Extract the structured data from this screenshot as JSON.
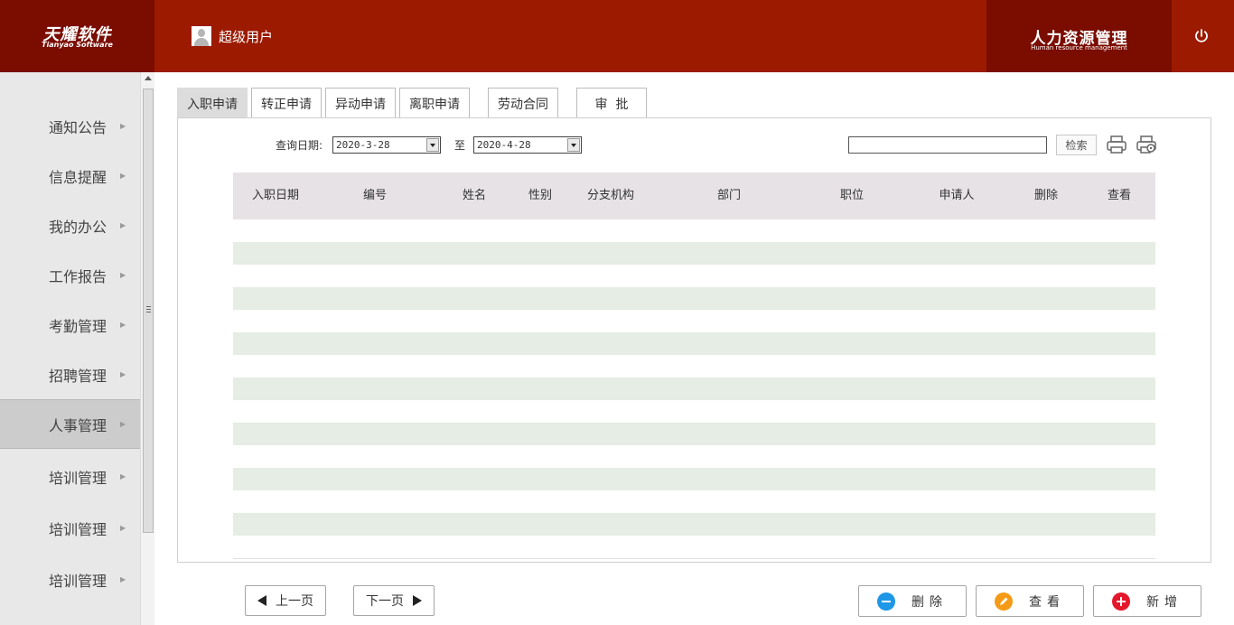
{
  "header": {
    "logo_cn": "天耀软件",
    "logo_en": "Tianyao Software",
    "user_name": "超级用户",
    "module_cn": "人力资源管理",
    "module_en": "Human resource management"
  },
  "sidebar": {
    "items": [
      {
        "label": "通知公告"
      },
      {
        "label": "信息提醒"
      },
      {
        "label": "我的办公"
      },
      {
        "label": "工作报告"
      },
      {
        "label": "考勤管理"
      },
      {
        "label": "招聘管理"
      },
      {
        "label": "人事管理",
        "active": true
      },
      {
        "label": "培训管理"
      },
      {
        "label": "培训管理"
      },
      {
        "label": "培训管理"
      }
    ]
  },
  "tabs": [
    {
      "label": "入职申请",
      "active": true
    },
    {
      "label": "转正申请"
    },
    {
      "label": "异动申请"
    },
    {
      "label": "离职申请"
    },
    {
      "label": "劳动合同"
    },
    {
      "label": "审  批"
    }
  ],
  "query": {
    "date_label": "查询日期:",
    "start_date": "2020-3-28",
    "to_label": "至",
    "end_date": "2020-4-28",
    "search_value": "",
    "search_button": "检索"
  },
  "table": {
    "columns": [
      "入职日期",
      "编号",
      "姓名",
      "性别",
      "分支机构",
      "部门",
      "职位",
      "申请人",
      "删除",
      "查看"
    ],
    "rows": []
  },
  "pagination": {
    "prev": "上一页",
    "next": "下一页"
  },
  "actions": {
    "delete": "删除",
    "view": "查看",
    "add": "新增"
  },
  "colors": {
    "header_bg": "#9c1a00",
    "header_dark": "#7a0c00",
    "row_alt": "#e6ede4",
    "table_head": "#e6e2e6"
  }
}
